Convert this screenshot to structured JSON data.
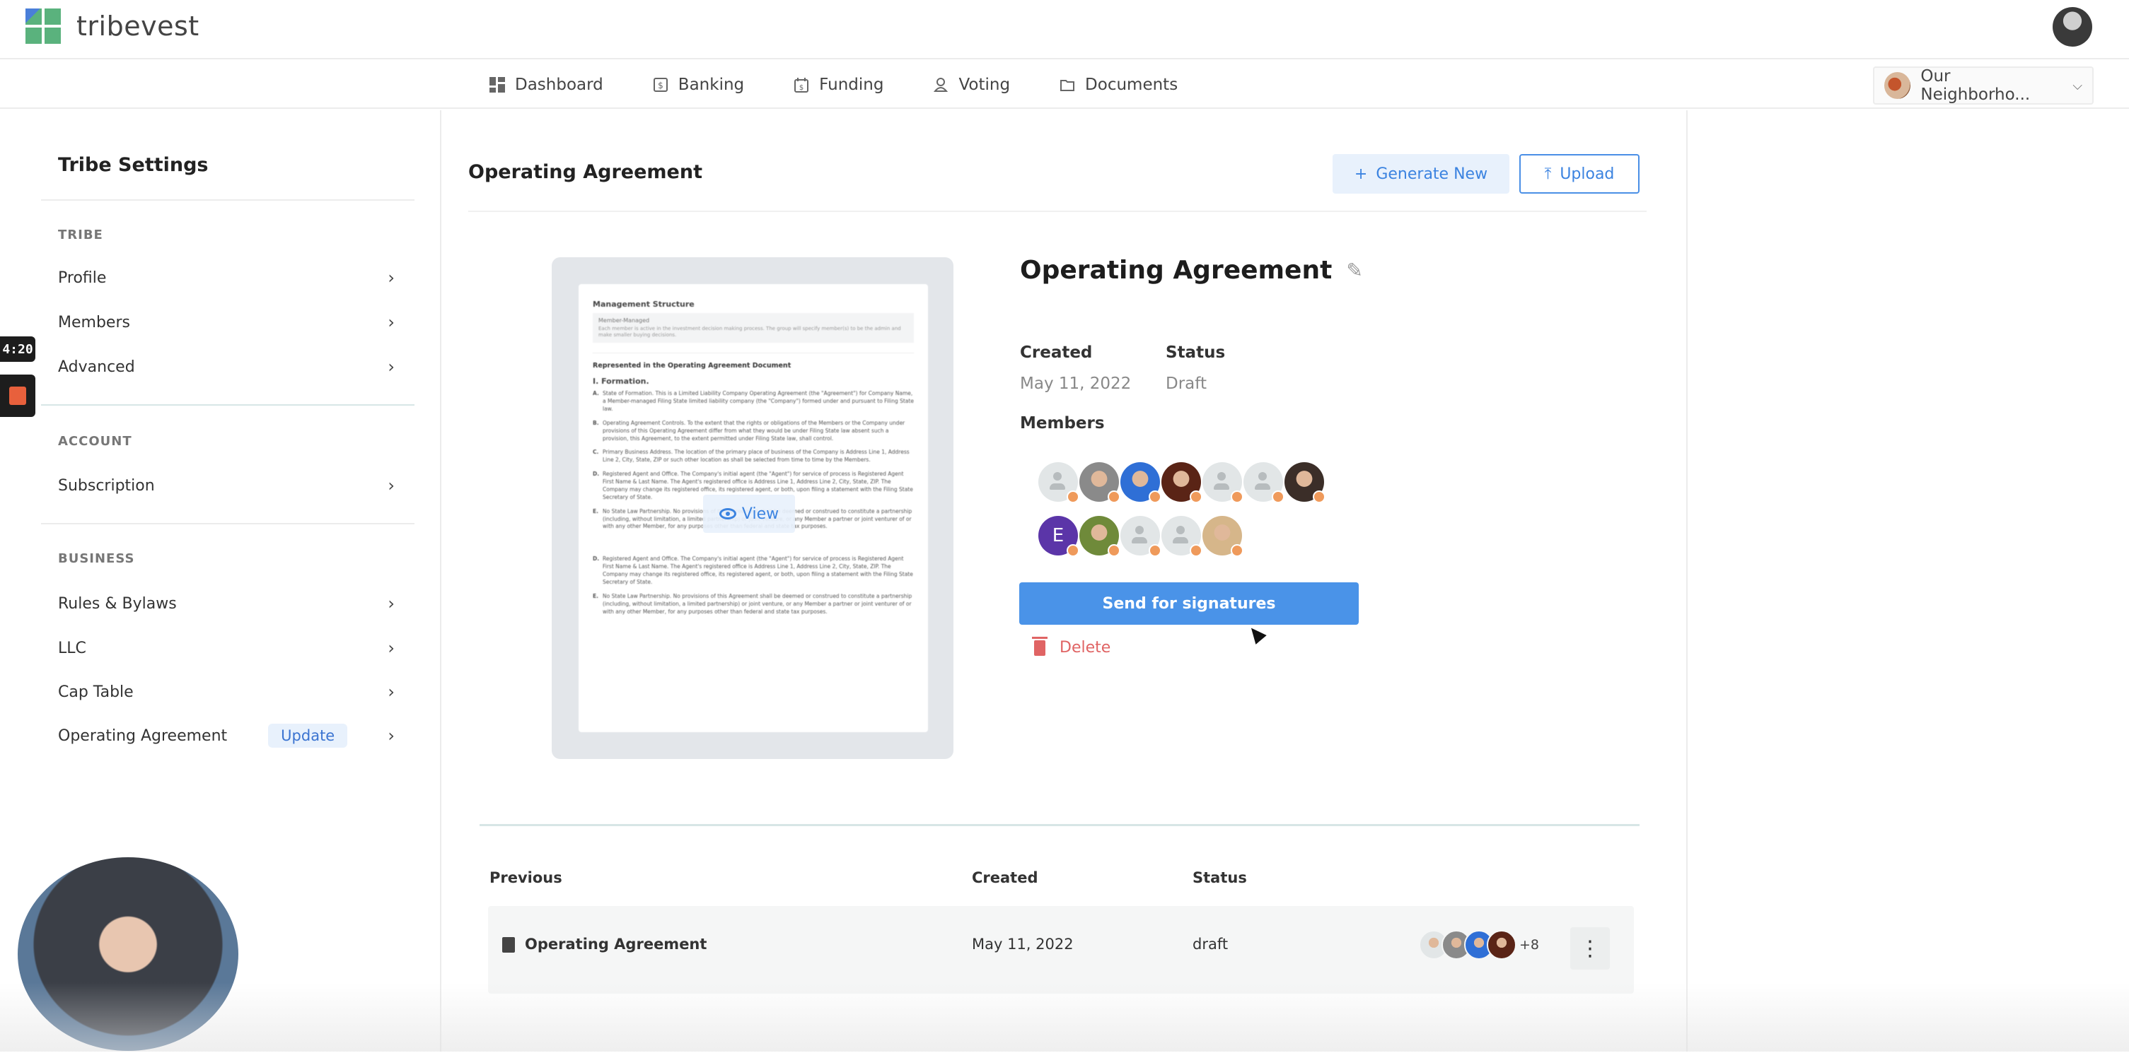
{
  "app": {
    "logo_text": "tribevest"
  },
  "nav": {
    "items": [
      {
        "label": "Dashboard",
        "icon": "dashboard-icon"
      },
      {
        "label": "Banking",
        "icon": "bank-dollar-icon"
      },
      {
        "label": "Funding",
        "icon": "calendar-dollar-icon"
      },
      {
        "label": "Voting",
        "icon": "vote-person-icon"
      },
      {
        "label": "Documents",
        "icon": "folder-icon"
      }
    ],
    "tribe_selector": "Our Neighborho..."
  },
  "recording": {
    "timer": "4:20"
  },
  "sidebar": {
    "title": "Tribe Settings",
    "sections": [
      {
        "heading": "TRIBE",
        "items": [
          {
            "label": "Profile"
          },
          {
            "label": "Members"
          },
          {
            "label": "Advanced"
          }
        ]
      },
      {
        "heading": "ACCOUNT",
        "items": [
          {
            "label": "Subscription"
          }
        ]
      },
      {
        "heading": "BUSINESS",
        "items": [
          {
            "label": "Rules & Bylaws"
          },
          {
            "label": "LLC"
          },
          {
            "label": "Cap Table"
          },
          {
            "label": "Operating Agreement",
            "badge": "Update"
          }
        ]
      }
    ]
  },
  "main": {
    "header_title": "Operating Agreement",
    "generate_label": "Generate New",
    "upload_label": "Upload",
    "preview": {
      "view_label": "View",
      "heading": "Management Structure",
      "box_title": "Member-Managed",
      "box_text": "Each member is active in the investment decision making process. The group will specify member(s) to be the admin and make smaller buying decisions.",
      "subheading": "Represented in the Operating Agreement Document",
      "section": "I. Formation.",
      "paragraphs": [
        {
          "letter": "A.",
          "text": "State of Formation. This is a Limited Liability Company Operating Agreement (the \"Agreement\") for Company Name, a Member-managed Filing State limited liability company (the \"Company\") formed under and pursuant to Filing State law."
        },
        {
          "letter": "B.",
          "text": "Operating Agreement Controls. To the extent that the rights or obligations of the Members or the Company under provisions of this Operating Agreement differ from what they would be under Filing State law absent such a provision, this Agreement, to the extent permitted under Filing State law, shall control."
        },
        {
          "letter": "C.",
          "text": "Primary Business Address. The location of the primary place of business of the Company is Address Line 1, Address Line 2, City, State, ZIP or such other location as shall be selected from time to time by the Members."
        },
        {
          "letter": "D.",
          "text": "Registered Agent and Office. The Company's initial agent (the \"Agent\") for service of process is Registered Agent First Name & Last Name. The Agent's registered office is Address Line 1, Address Line 2, City, State, ZIP. The Company may change its registered office, its registered agent, or both, upon filing a statement with the Filing State Secretary of State."
        },
        {
          "letter": "E.",
          "text": "No State Law Partnership. No provisions of this Agreement shall be deemed or construed to constitute a partnership (including, without limitation, a limited partnership) or joint venture, or any Member a partner or joint venturer of or with any other Member, for any purposes other than federal and state tax purposes."
        }
      ],
      "paragraphs_repeat": [
        {
          "letter": "D.",
          "text": "Registered Agent and Office. The Company's initial agent (the \"Agent\") for service of process is Registered Agent First Name & Last Name. The Agent's registered office is Address Line 1, Address Line 2, City, State, ZIP. The Company may change its registered office, its registered agent, or both, upon filing a statement with the Filing State Secretary of State."
        },
        {
          "letter": "E.",
          "text": "No State Law Partnership. No provisions of this Agreement shall be deemed or construed to constitute a partnership (including, without limitation, a limited partnership) or joint venture, or any Member a partner or joint venturer of or with any other Member, for any purposes other than federal and state tax purposes."
        }
      ]
    },
    "detail": {
      "title": "Operating Agreement",
      "created_label": "Created",
      "created_value": "May 11, 2022",
      "status_label": "Status",
      "status_value": "Draft",
      "members_label": "Members",
      "members": [
        {
          "type": "placeholder"
        },
        {
          "type": "photo",
          "color": "#8a8a8a"
        },
        {
          "type": "photo",
          "color": "#2f6fd6"
        },
        {
          "type": "photo",
          "color": "#5a2416"
        },
        {
          "type": "placeholder"
        },
        {
          "type": "placeholder"
        },
        {
          "type": "photo",
          "color": "#3b2e28"
        },
        {
          "type": "initial",
          "initial": "E",
          "color": "#5b35a8"
        },
        {
          "type": "photo",
          "color": "#6f8a3a"
        },
        {
          "type": "placeholder"
        },
        {
          "type": "placeholder"
        },
        {
          "type": "photo",
          "color": "#d6b68a"
        }
      ],
      "send_label": "Send for signatures",
      "delete_label": "Delete"
    },
    "previous": {
      "headers": {
        "name": "Previous",
        "created": "Created",
        "status": "Status"
      },
      "rows": [
        {
          "name": "Operating Agreement",
          "created": "May 11, 2022",
          "status": "draft",
          "more_members": "+8",
          "avatar_colors": [
            "#e2e6e7",
            "#8a8a8a",
            "#2f6fd6",
            "#5a2416"
          ]
        }
      ]
    }
  },
  "colors": {
    "primary": "#4a93e8",
    "danger": "#e06464",
    "status_dot": "#ef9a5b",
    "badge_bg": "#e8f1fc"
  }
}
